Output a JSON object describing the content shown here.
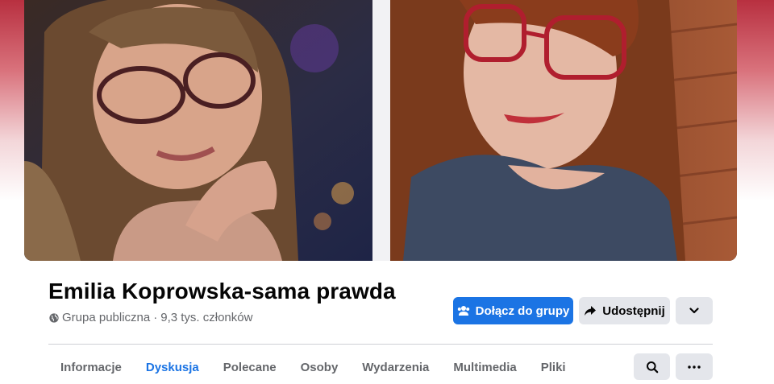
{
  "group": {
    "name": "Emilia Koprowska-sama prawda",
    "privacy": "Grupa publiczna",
    "separator": "·",
    "members": "9,3 tys. członków"
  },
  "actions": {
    "join_label": "Dołącz do grupy",
    "share_label": "Udostępnij"
  },
  "tabs": [
    {
      "label": "Informacje",
      "active": false
    },
    {
      "label": "Dyskusja",
      "active": true
    },
    {
      "label": "Polecane",
      "active": false
    },
    {
      "label": "Osoby",
      "active": false
    },
    {
      "label": "Wydarzenia",
      "active": false
    },
    {
      "label": "Multimedia",
      "active": false
    },
    {
      "label": "Pliki",
      "active": false
    }
  ],
  "colors": {
    "accent": "#1b74e4",
    "button_grey": "#e4e6eb",
    "banner_red": "#b83040"
  },
  "icons": {
    "privacy": "globe-icon",
    "join": "people-icon",
    "share": "share-arrow-icon",
    "more": "chevron-down-icon",
    "search": "search-icon",
    "tab_more": "more-dots-icon"
  }
}
